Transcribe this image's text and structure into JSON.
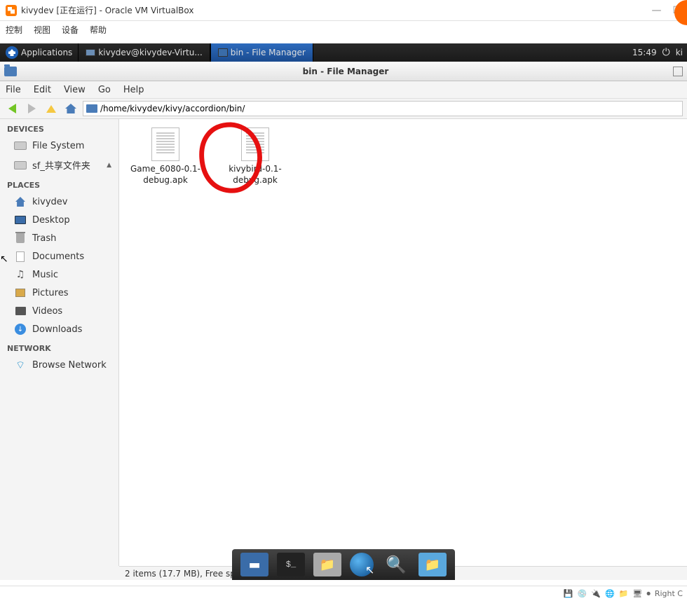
{
  "vbox": {
    "title": "kivydev [正在运行] - Oracle VM VirtualBox",
    "menu": [
      "控制",
      "视图",
      "设备",
      "帮助"
    ],
    "status_right": "Right C"
  },
  "panel": {
    "applications": "Applications",
    "task1": "kivydev@kivydev-Virtu...",
    "task2": "bin - File Manager",
    "clock": "15:49",
    "user_hint": "ki"
  },
  "fm": {
    "title": "bin - File Manager",
    "menu": [
      "File",
      "Edit",
      "View",
      "Go",
      "Help"
    ],
    "path": "/home/kivydev/kivy/accordion/bin/",
    "status": "2 items (17.7 MB), Free space: 5.9 GB"
  },
  "sidebar": {
    "devices_header": "DEVICES",
    "devices": [
      {
        "label": "File System"
      },
      {
        "label": "sf_共享文件夹"
      }
    ],
    "places_header": "PLACES",
    "places": [
      {
        "label": "kivydev"
      },
      {
        "label": "Desktop"
      },
      {
        "label": "Trash"
      },
      {
        "label": "Documents"
      },
      {
        "label": "Music"
      },
      {
        "label": "Pictures"
      },
      {
        "label": "Videos"
      },
      {
        "label": "Downloads"
      }
    ],
    "network_header": "NETWORK",
    "network": [
      {
        "label": "Browse Network"
      }
    ]
  },
  "files": [
    {
      "name": "Game_6080-0.1-debug.apk"
    },
    {
      "name": "kivybird-0.1-debug.apk"
    }
  ]
}
